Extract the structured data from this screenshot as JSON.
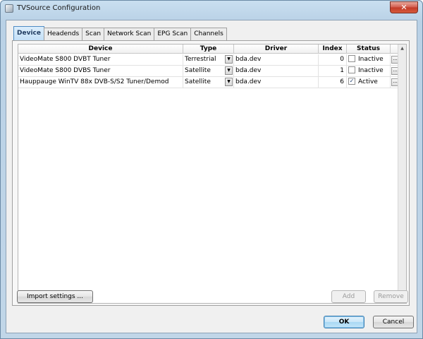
{
  "window": {
    "title": "TVSource Configuration",
    "close_glyph": "✕"
  },
  "tabs": [
    {
      "label": "Device",
      "active": true
    },
    {
      "label": "Headends",
      "active": false
    },
    {
      "label": "Scan",
      "active": false
    },
    {
      "label": "Network Scan",
      "active": false
    },
    {
      "label": "EPG Scan",
      "active": false
    },
    {
      "label": "Channels",
      "active": false
    }
  ],
  "grid": {
    "columns": [
      "Device",
      "Type",
      "Driver",
      "Index",
      "Status"
    ],
    "rows": [
      {
        "device": "VideoMate S800 DVBT Tuner",
        "type": "Terrestrial",
        "driver": "bda.dev",
        "index": "0",
        "checked": false,
        "status": "Inactive"
      },
      {
        "device": "VideoMate S800 DVBS Tuner",
        "type": "Satellite",
        "driver": "bda.dev",
        "index": "1",
        "checked": false,
        "status": "Inactive"
      },
      {
        "device": "Hauppauge WinTV 88x DVB-S/S2 Tuner/Demod",
        "type": "Satellite",
        "driver": "bda.dev",
        "index": "6",
        "checked": true,
        "status": "Active"
      }
    ],
    "dropdown_glyph": "▼",
    "ellipsis_glyph": "...",
    "check_glyph": "✓",
    "scroll_up_glyph": "▲",
    "scroll_down_glyph": "▼"
  },
  "buttons": {
    "import": "Import settings ...",
    "add": "Add",
    "remove": "Remove",
    "ok": "OK",
    "cancel": "Cancel"
  }
}
